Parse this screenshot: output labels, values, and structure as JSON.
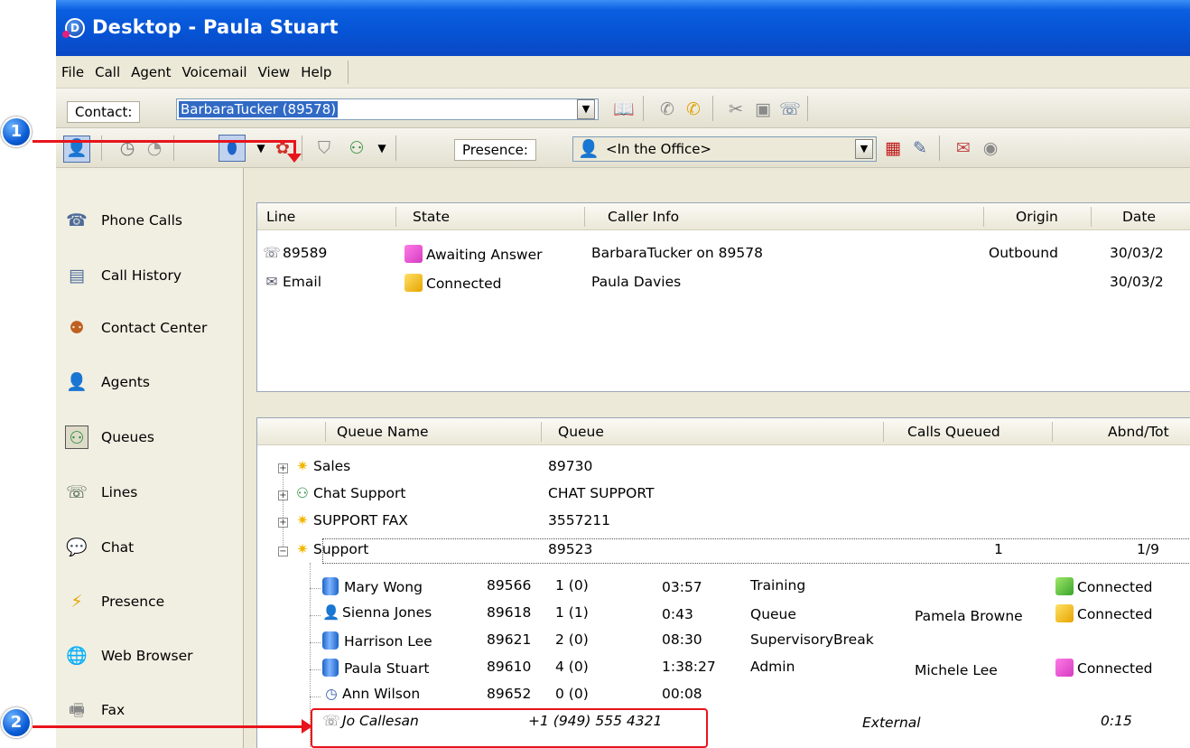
{
  "window": {
    "title": "Desktop - Paula Stuart",
    "app_icon_letter": "D"
  },
  "menu": [
    "File",
    "Call",
    "Agent",
    "Voicemail",
    "View",
    "Help"
  ],
  "contact_bar": {
    "label": "Contact:",
    "value": "BarbaraTucker (89578)"
  },
  "toolbar": {
    "presence_label": "Presence:",
    "presence_value": "<In the Office>"
  },
  "nav": [
    "Phone Calls",
    "Call History",
    "Contact Center",
    "Agents",
    "Queues",
    "Lines",
    "Chat",
    "Presence",
    "Web Browser",
    "Fax"
  ],
  "calls": {
    "columns": [
      "Line",
      "State",
      "Caller Info",
      "Origin",
      "Date"
    ],
    "rows": [
      {
        "line": "89589",
        "state": "Awaiting Answer",
        "caller": "BarbaraTucker on 89578",
        "origin": "Outbound",
        "date": "30/03/2"
      },
      {
        "line": "Email",
        "state": "Connected",
        "caller": "Paula Davies",
        "origin": "",
        "date": "30/03/2"
      }
    ]
  },
  "queues": {
    "columns": [
      "Queue Name",
      "Queue",
      "Calls Queued",
      "Abnd/Tot"
    ],
    "rows": [
      {
        "name": "Sales",
        "queue": "89730",
        "calls": "",
        "abnd": ""
      },
      {
        "name": "Chat Support",
        "queue": "CHAT SUPPORT",
        "calls": "",
        "abnd": ""
      },
      {
        "name": "SUPPORT FAX",
        "queue": "3557211",
        "calls": "",
        "abnd": ""
      },
      {
        "name": "Support",
        "queue": "89523",
        "calls": "1",
        "abnd": "1/9"
      }
    ],
    "agents": [
      {
        "name": "Mary Wong",
        "ext": "89566",
        "count": "1 (0)",
        "time": "03:57",
        "status": "Training",
        "with": "",
        "state": "Connected"
      },
      {
        "name": "Sienna Jones",
        "ext": "89618",
        "count": "1 (1)",
        "time": "0:43",
        "status": "Queue",
        "with": "Pamela Browne",
        "state": "Connected"
      },
      {
        "name": "Harrison Lee",
        "ext": "89621",
        "count": "2 (0)",
        "time": "08:30",
        "status": "SupervisoryBreak",
        "with": "",
        "state": ""
      },
      {
        "name": "Paula Stuart",
        "ext": "89610",
        "count": "4 (0)",
        "time": "1:38:27",
        "status": "Admin",
        "with": "Michele Lee",
        "state": "Connected"
      },
      {
        "name": "Ann Wilson",
        "ext": "89652",
        "count": "0 (0)",
        "time": "00:08",
        "status": "",
        "with": "",
        "state": ""
      }
    ],
    "call_row": {
      "name": "Jo Callesan",
      "number": "+1 (949) 555 4321",
      "type": "External",
      "time": "0:15"
    }
  },
  "callouts": [
    "1",
    "2"
  ],
  "colors": {
    "accent": "#0653d4",
    "callout_red": "#e8141c",
    "selection": "#316ac5"
  }
}
